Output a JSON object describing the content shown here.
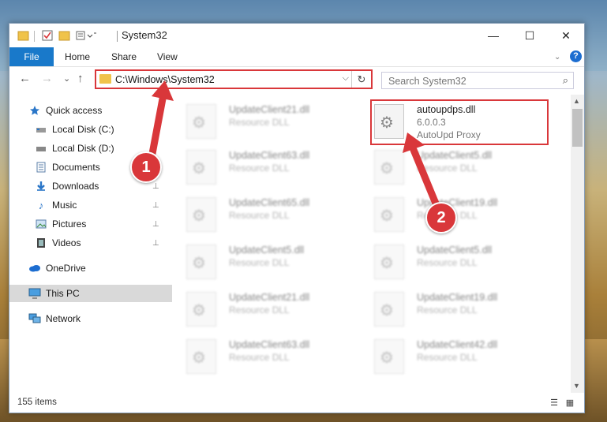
{
  "window": {
    "title": "System32",
    "controls": {
      "minimize": "—",
      "maximize": "☐",
      "close": "✕"
    }
  },
  "ribbon": {
    "file": "File",
    "tabs": [
      "Home",
      "Share",
      "View"
    ],
    "help": "?"
  },
  "address": {
    "path": "C:\\Windows\\System32",
    "dropdown": "⌵",
    "refresh": "↻"
  },
  "search": {
    "placeholder": "Search System32",
    "icon": "⌕"
  },
  "nav": {
    "back": "←",
    "forward": "→",
    "recent": "⌄",
    "up": "↑",
    "items": [
      {
        "label": "Quick access",
        "icon": "star-icon",
        "pinned": false
      },
      {
        "label": "Local Disk (C:)",
        "icon": "drive-icon",
        "pinned": false
      },
      {
        "label": "Local Disk (D:)",
        "icon": "drive-icon",
        "pinned": false
      },
      {
        "label": "Documents",
        "icon": "documents-icon",
        "pinned": true
      },
      {
        "label": "Downloads",
        "icon": "downloads-icon",
        "pinned": true
      },
      {
        "label": "Music",
        "icon": "music-icon",
        "pinned": true
      },
      {
        "label": "Pictures",
        "icon": "pictures-icon",
        "pinned": true
      },
      {
        "label": "Videos",
        "icon": "videos-icon",
        "pinned": true
      },
      {
        "label": "OneDrive",
        "icon": "cloud-icon",
        "pinned": false
      },
      {
        "label": "This PC",
        "icon": "monitor-icon",
        "pinned": false
      },
      {
        "label": "Network",
        "icon": "network-icon",
        "pinned": false
      }
    ],
    "pin_glyph": "📌"
  },
  "files": {
    "highlighted": {
      "name": "autoupdps.dll",
      "version": "6.0.0.3",
      "description": "AutoUpd Proxy"
    },
    "left_column": [
      {
        "name": "UpdateClient21.dll",
        "description": "Resource DLL"
      },
      {
        "name": "UpdateClient63.dll",
        "description": "Resource DLL"
      },
      {
        "name": "UpdateClient65.dll",
        "description": "Resource DLL"
      },
      {
        "name": "UpdateClient5.dll",
        "description": "Resource DLL"
      },
      {
        "name": "UpdateClient21.dll",
        "description": "Resource DLL"
      },
      {
        "name": "UpdateClient63.dll",
        "description": "Resource DLL"
      }
    ],
    "right_column": [
      {
        "name": "UpdateClient5.dll",
        "description": "Resource DLL"
      },
      {
        "name": "UpdateClient19.dll",
        "description": "Resource DLL"
      },
      {
        "name": "UpdateClient5.dll",
        "description": "Resource DLL"
      },
      {
        "name": "UpdateClient19.dll",
        "description": "Resource DLL"
      },
      {
        "name": "UpdateClient42.dll",
        "description": "Resource DLL"
      }
    ]
  },
  "status": {
    "count": "155 items"
  },
  "callouts": {
    "one": "1",
    "two": "2"
  },
  "colors": {
    "accent": "#1979ca",
    "highlight": "#d9373a"
  }
}
